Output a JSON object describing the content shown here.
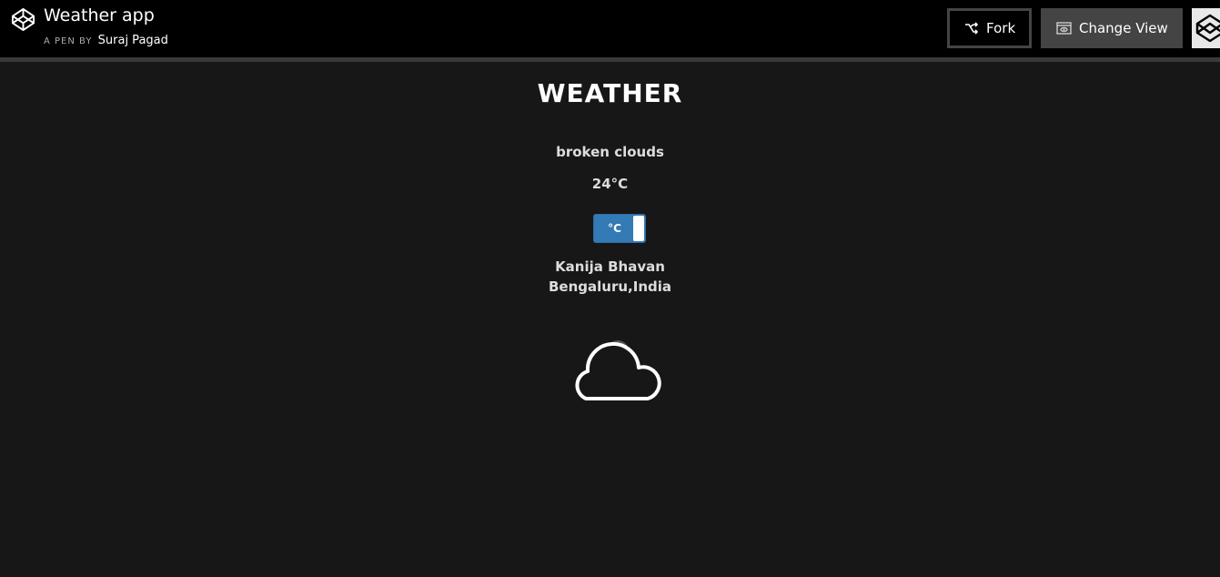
{
  "header": {
    "title": "Weather app",
    "by_label": "A PEN BY",
    "author": "Suraj Pagad",
    "fork_label": "Fork",
    "change_view_label": "Change View"
  },
  "weather": {
    "heading": "WEATHER",
    "description": "broken clouds",
    "temperature": "24°C",
    "unit_toggle": "°C",
    "location_line1": "Kanija Bhavan",
    "location_line2": "Bengaluru,India",
    "icon": "cloud-icon"
  },
  "colors": {
    "background": "#171717",
    "topbar": "#000000",
    "toggle": "#337ab7",
    "change_view_button": "#444444"
  }
}
